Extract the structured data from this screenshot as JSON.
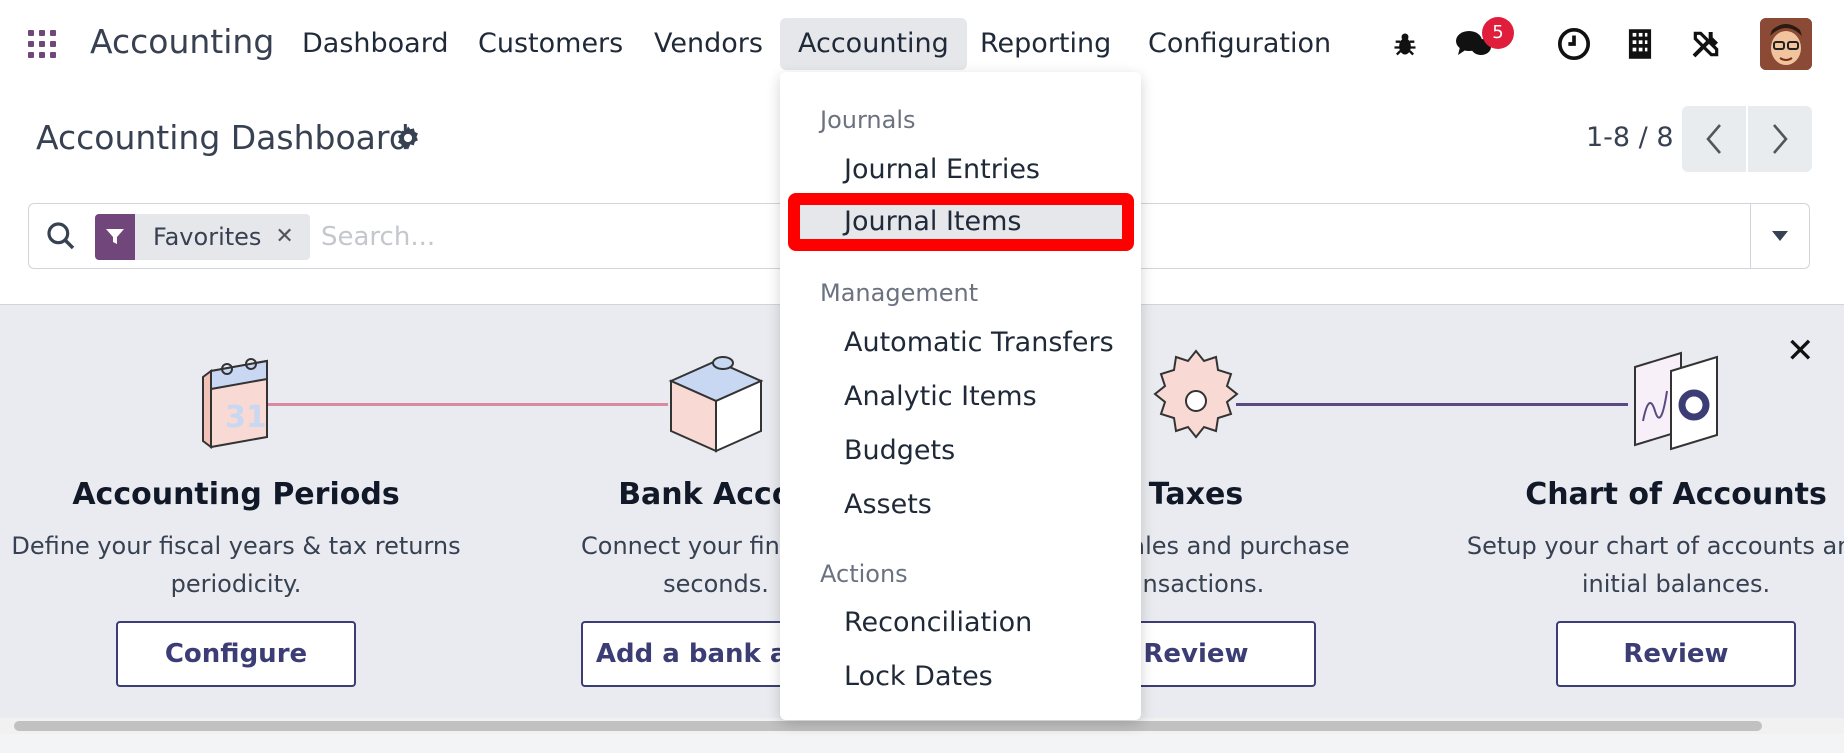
{
  "navbar": {
    "app_title": "Accounting",
    "menu": [
      {
        "label": "Dashboard"
      },
      {
        "label": "Customers"
      },
      {
        "label": "Vendors"
      },
      {
        "label": "Accounting"
      },
      {
        "label": "Reporting"
      },
      {
        "label": "Configuration"
      }
    ],
    "active_menu": "Accounting",
    "messages_badge": "5",
    "icons": [
      "apps-icon",
      "bug-icon",
      "chat-icon",
      "clock-icon",
      "building-icon",
      "tools-icon",
      "avatar"
    ]
  },
  "control_panel": {
    "title": "Accounting Dashboard",
    "pager": "1-8 / 8",
    "search": {
      "facet_label": "Favorites",
      "placeholder": "Search..."
    }
  },
  "onboarding": {
    "steps": [
      {
        "title": "Accounting Periods",
        "desc_line1": "Define your fiscal years & tax returns",
        "desc_line2": "periodicity.",
        "button": "Configure"
      },
      {
        "title": "Bank Accou",
        "desc_line1": "Connect your financial",
        "desc_line2": "seconds.",
        "button": "Add a bank acco"
      },
      {
        "title": "Taxes",
        "desc_line1": "es for sales and purchase",
        "desc_line2": "ansactions.",
        "button": "Review"
      },
      {
        "title": "Chart of Accounts",
        "desc_line1": "Setup your chart of accounts and r",
        "desc_line2": "initial balances.",
        "button": "Review"
      }
    ]
  },
  "dropdown": {
    "sections": [
      {
        "header": "Journals",
        "items": [
          "Journal Entries",
          "Journal Items"
        ]
      },
      {
        "header": "Management",
        "items": [
          "Automatic Transfers",
          "Analytic Items",
          "Budgets",
          "Assets"
        ]
      },
      {
        "header": "Actions",
        "items": [
          "Reconciliation",
          "Lock Dates"
        ]
      }
    ],
    "highlighted_item": "Journal Items"
  },
  "colors": {
    "brand_purple": "#71477b",
    "badge_red": "#e01e3c",
    "highlight_red": "#ff0000",
    "button_navy": "#3b3d74"
  }
}
